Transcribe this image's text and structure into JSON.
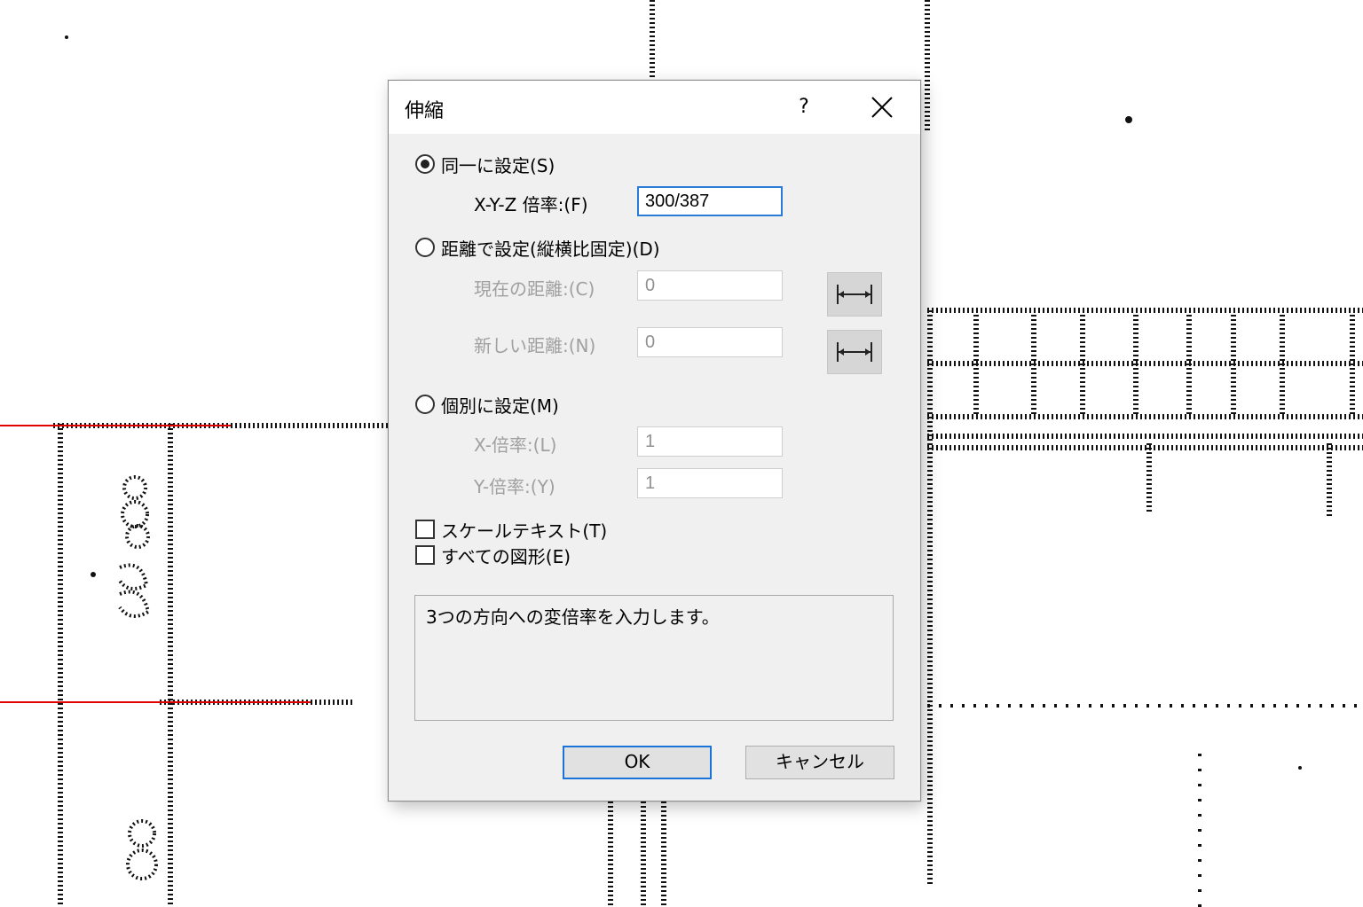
{
  "dialog": {
    "title": "伸縮",
    "help_label": "?",
    "same_option": {
      "label": "同一に設定(S)",
      "selected": true,
      "factor_label": "X-Y-Z 倍率:(F)",
      "factor_value": "300/387"
    },
    "distance_option": {
      "label": "距離で設定(縦横比固定)(D)",
      "selected": false,
      "current_label": "現在の距離:(C)",
      "current_value": "0",
      "new_label": "新しい距離:(N)",
      "new_value": "0"
    },
    "individual_option": {
      "label": "個別に設定(M)",
      "selected": false,
      "x_label": "X-倍率:(L)",
      "x_value": "1",
      "y_label": "Y-倍率:(Y)",
      "y_value": "1"
    },
    "scale_text": {
      "label": "スケールテキスト(T)",
      "checked": false
    },
    "all_shapes": {
      "label": "すべての図形(E)",
      "checked": false
    },
    "description": "3つの方向への変倍率を入力します。",
    "ok_label": "OK",
    "cancel_label": "キャンセル"
  },
  "colors": {
    "accent": "#2a7ad7",
    "dialog_bg": "#f0f0f0",
    "red_line": "#e00000"
  }
}
